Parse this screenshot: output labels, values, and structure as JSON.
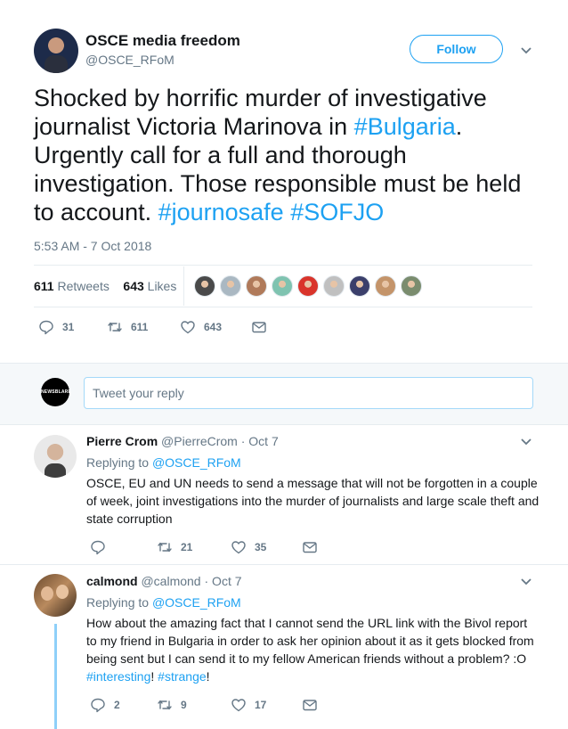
{
  "tweet": {
    "author_name": "OSCE media freedom",
    "author_handle": "@OSCE_RFoM",
    "follow_label": "Follow",
    "text_part1": "Shocked by horrific murder of investigative journalist Victoria Marinova in ",
    "hashtag1": "#Bulgaria",
    "text_part2": ". Urgently call for a full and thorough investigation. Those responsible must be held to account. ",
    "hashtag2": "#journosafe",
    "hashtag3": "#SOFJO",
    "timestamp": "5:53 AM - 7 Oct 2018",
    "retweets_count": "611",
    "retweets_label": "Retweets",
    "likes_count": "643",
    "likes_label": "Likes",
    "liker_colors": [
      "#4a4a4a",
      "#aab8c2",
      "#b07a5a",
      "#7fc3b0",
      "#d9342b",
      "#c0c0c0",
      "#3b3f6b",
      "#c4946a",
      "#7a8c6e"
    ],
    "actions": {
      "replies": "31",
      "retweets": "611",
      "likes": "643"
    }
  },
  "reply_box": {
    "avatar_text": "NEWSBLARE",
    "placeholder": "Tweet your reply"
  },
  "replies": [
    {
      "name": "Pierre Crom",
      "handle": "@PierreCrom",
      "date": "· Oct 7",
      "replying_prefix": "Replying to ",
      "replying_to": "@OSCE_RFoM",
      "text": "OSCE, EU and UN needs to send a message that will not be forgotten in a couple of week, joint investigations into the murder of journalists and large scale theft and state corruption",
      "retweets": "21",
      "likes": "35"
    },
    {
      "name": "calmond",
      "handle": "@calmond",
      "date": "· Oct 7",
      "replying_prefix": "Replying to ",
      "replying_to": "@OSCE_RFoM",
      "text": "How about the amazing fact that I cannot send the URL link with the Bivol report to my friend in Bulgaria in order to ask her opinion about it as it gets blocked from being sent but I can send it to my fellow American friends without a problem? :O ",
      "hashtag1": "#interesting",
      "mid": "! ",
      "hashtag2": "#strange",
      "end": "!",
      "replies": "2",
      "retweets": "9",
      "likes": "17"
    }
  ]
}
